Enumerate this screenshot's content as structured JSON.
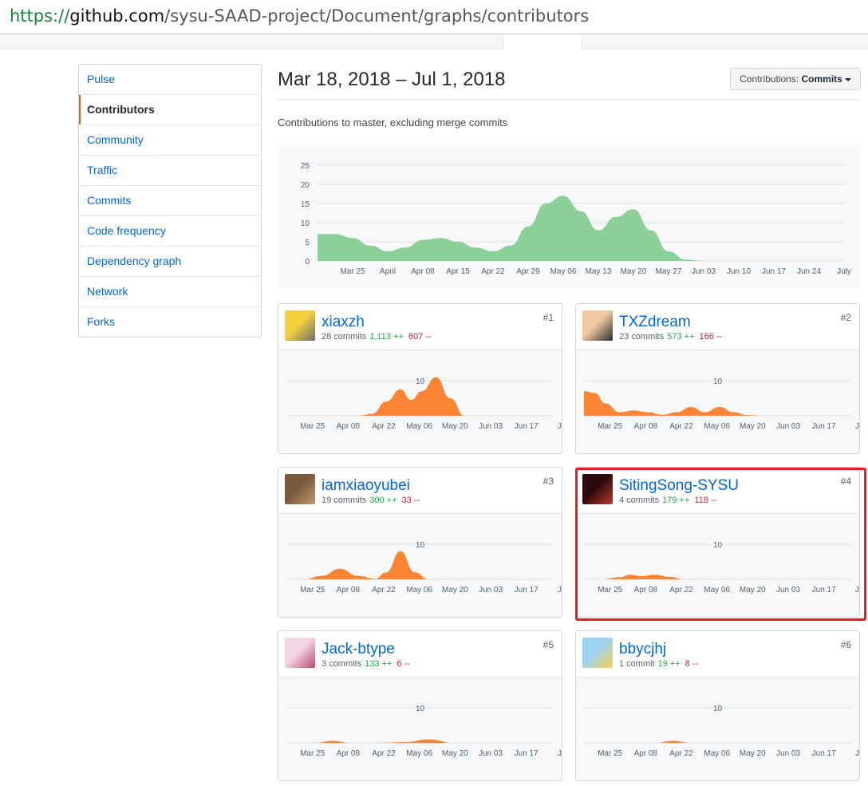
{
  "browser": {
    "url_scheme": "https://",
    "url_host": "github.com",
    "url_path": "/sysu-SAAD-project/Document/graphs/contributors"
  },
  "sidebar": {
    "items": [
      {
        "label": "Pulse",
        "selected": false
      },
      {
        "label": "Contributors",
        "selected": true
      },
      {
        "label": "Community",
        "selected": false
      },
      {
        "label": "Traffic",
        "selected": false
      },
      {
        "label": "Commits",
        "selected": false
      },
      {
        "label": "Code frequency",
        "selected": false
      },
      {
        "label": "Dependency graph",
        "selected": false
      },
      {
        "label": "Network",
        "selected": false
      },
      {
        "label": "Forks",
        "selected": false
      }
    ]
  },
  "header": {
    "date_range": "Mar 18, 2018 – Jul 1, 2018",
    "dropdown_prefix": "Contributions:",
    "dropdown_value": "Commits",
    "subtitle": "Contributions to master, excluding merge commits"
  },
  "colors": {
    "main_area": "#8ccf98",
    "contrib_area": "#fb8532",
    "link": "#0366d6",
    "additions": "#28a745",
    "deletions": "#cb2431",
    "highlight": "#e02020"
  },
  "chart_data": [
    {
      "type": "area",
      "ylim": [
        0,
        25
      ],
      "y_ticks": [
        "0",
        "5",
        "10",
        "15",
        "20",
        "25"
      ],
      "x_ticks": [
        "Mar 25",
        "April",
        "Apr 08",
        "Apr 15",
        "Apr 22",
        "Apr 29",
        "May 06",
        "May 13",
        "May 20",
        "May 27",
        "Jun 03",
        "Jun 10",
        "Jun 17",
        "Jun 24",
        "July"
      ],
      "x_positions": [
        1,
        2,
        3,
        4,
        5,
        6,
        7,
        8,
        9,
        10,
        11,
        12,
        13,
        14,
        15
      ],
      "series": [
        {
          "x": [
            0,
            0.5,
            1,
            1.5,
            2,
            2.5,
            3,
            3.5,
            4,
            4.5,
            5,
            5.5,
            6,
            6.5,
            7,
            7.5,
            8,
            8.5,
            9,
            9.5,
            10,
            10.5,
            11,
            15
          ],
          "values": [
            7,
            7,
            6,
            4,
            2.5,
            3.5,
            5.5,
            6,
            5,
            3.5,
            2.5,
            4,
            9,
            15,
            17,
            13,
            8,
            11.5,
            13.5,
            8,
            2.5,
            0.3,
            0,
            0
          ]
        }
      ]
    },
    {
      "type": "area",
      "ylim": [
        0,
        15
      ],
      "y_ticks": [
        "10"
      ],
      "x_ticks": [
        "Mar 25",
        "Apr 08",
        "Apr 22",
        "May 06",
        "May 20",
        "Jun 03",
        "Jun 17",
        "Ju"
      ],
      "contributors": [
        {
          "rank": "#1",
          "login": "xiaxzh",
          "commits": "28 commits",
          "additions": "1,113 ++",
          "deletions": "607 --",
          "x": [
            0,
            2,
            2.4,
            2.8,
            3.2,
            3.5,
            3.8,
            4.2,
            4.6,
            5,
            7.5
          ],
          "values": [
            0,
            0,
            0.5,
            4,
            7.5,
            4.5,
            7,
            11,
            5,
            0,
            0
          ]
        },
        {
          "rank": "#2",
          "login": "TXZdream",
          "commits": "23 commits",
          "additions": "573 ++",
          "deletions": "166 --",
          "x": [
            0,
            0.3,
            0.6,
            1,
            1.4,
            1.8,
            2.2,
            2.6,
            3,
            3.4,
            3.8,
            4.2,
            4.6,
            5,
            7.5
          ],
          "values": [
            7,
            6.5,
            3.5,
            1,
            1.5,
            1,
            0.3,
            1,
            2.5,
            1,
            2.5,
            1,
            0.2,
            0,
            0
          ]
        },
        {
          "rank": "#3",
          "login": "iamxiaoyubei",
          "commits": "19 commits",
          "additions": "300 ++",
          "deletions": "33 --",
          "x": [
            0,
            0.5,
            1,
            1.5,
            2,
            2.5,
            2.8,
            3.2,
            3.6,
            4,
            7.5
          ],
          "values": [
            0,
            0,
            1,
            3,
            1,
            0.2,
            2,
            8,
            2,
            0,
            0
          ]
        },
        {
          "rank": "#4",
          "login": "SitingSong-SYSU",
          "commits": "4 commits",
          "additions": "179 ++",
          "deletions": "118 --",
          "highlighted": true,
          "x": [
            0,
            0.5,
            1,
            1.3,
            1.6,
            2,
            2.4,
            2.8,
            3.2,
            7.5
          ],
          "values": [
            0,
            0,
            0.6,
            1.3,
            0.9,
            1.3,
            0.7,
            0,
            0,
            0
          ]
        },
        {
          "rank": "#5",
          "login": "Jack-btype",
          "commits": "3 commits",
          "additions": "133 ++",
          "deletions": "6 --",
          "x": [
            0,
            0.8,
            1.3,
            1.8,
            2.5,
            3.3,
            4,
            4.7,
            7.5
          ],
          "values": [
            0,
            0,
            0.6,
            0,
            0,
            0.2,
            1,
            0,
            0
          ]
        },
        {
          "rank": "#6",
          "login": "bbycjhj",
          "commits": "1 commit",
          "additions": "19 ++",
          "deletions": "8 --",
          "x": [
            0,
            2,
            2.5,
            3,
            3.5,
            7.5
          ],
          "values": [
            0,
            0,
            0.6,
            0,
            0,
            0
          ]
        }
      ]
    }
  ]
}
